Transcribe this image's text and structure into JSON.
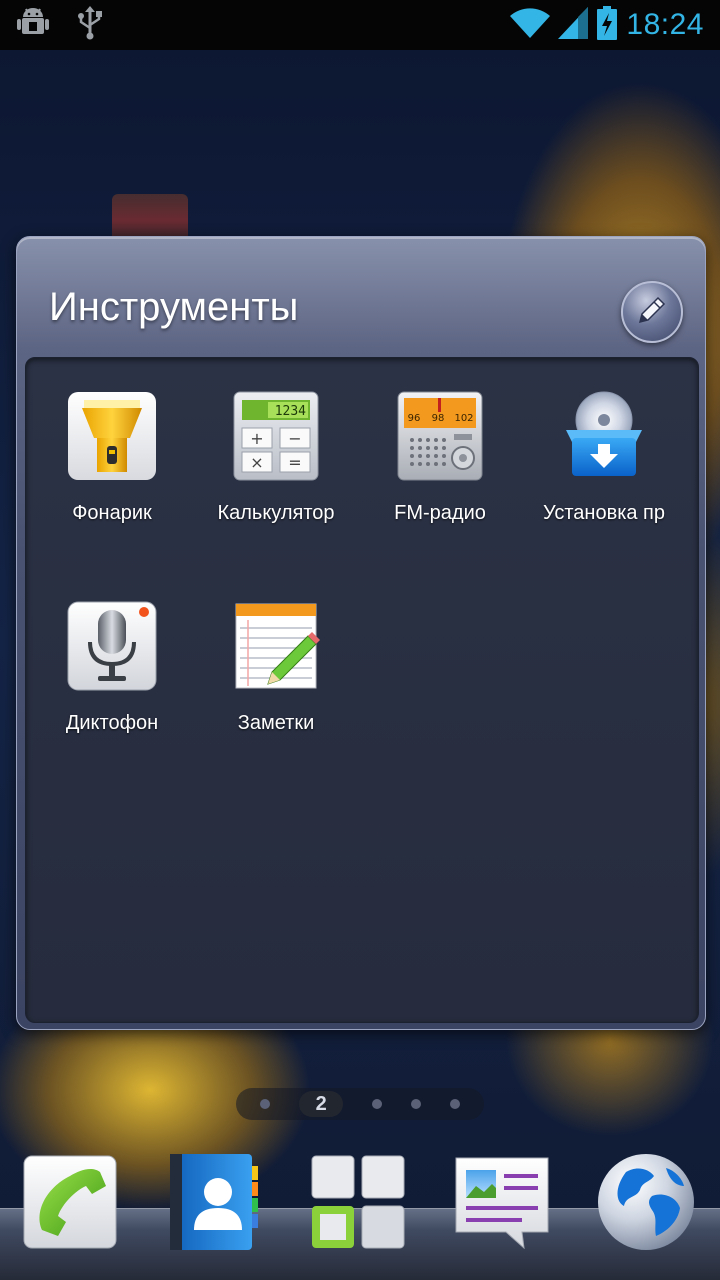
{
  "status_bar": {
    "time": "18:24",
    "left_icons": [
      "android-debug-icon",
      "usb-icon"
    ],
    "right_icons": [
      "wifi-icon",
      "signal-icon",
      "battery-charging-icon"
    ]
  },
  "folder": {
    "title": "Инструменты",
    "edit_icon": "pencil-icon",
    "apps": [
      {
        "label": "Фонарик",
        "icon": "flashlight-icon"
      },
      {
        "label": "Калькулятор",
        "icon": "calculator-icon",
        "display": "1234"
      },
      {
        "label": "FM-радио",
        "icon": "fm-radio-icon",
        "dial": [
          "96",
          "98",
          "102"
        ]
      },
      {
        "label": "Установка пр",
        "icon": "app-installer-icon"
      },
      {
        "label": "Диктофон",
        "icon": "voice-recorder-icon"
      },
      {
        "label": "Заметки",
        "icon": "notes-icon"
      }
    ]
  },
  "pager": {
    "current_page": "2",
    "total_dots": 5
  },
  "dock": {
    "items": [
      {
        "name": "phone",
        "icon": "phone-icon"
      },
      {
        "name": "contacts",
        "icon": "contacts-icon"
      },
      {
        "name": "all-apps",
        "icon": "app-drawer-icon"
      },
      {
        "name": "messages",
        "icon": "messages-icon"
      },
      {
        "name": "browser",
        "icon": "globe-icon"
      }
    ]
  },
  "colors": {
    "status_time": "#33b5e5",
    "folder_bg": "#262c3d",
    "folder_frame": "#5d6584"
  }
}
